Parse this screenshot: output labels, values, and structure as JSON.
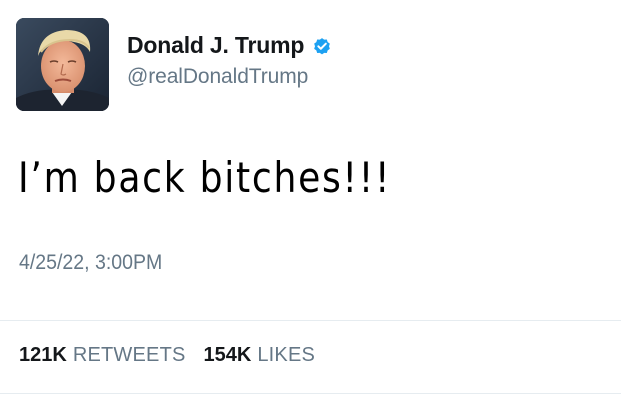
{
  "tweet": {
    "author": {
      "display_name": "Donald J. Trump",
      "handle": "@realDonaldTrump",
      "verified": true,
      "avatar": "profile-photo"
    },
    "text": "I’m back bitches!!!",
    "timestamp": "4/25/22, 3:00PM",
    "stats": {
      "retweets": {
        "count": "121K",
        "label": "RETWEETS"
      },
      "likes": {
        "count": "154K",
        "label": "LIKES"
      }
    }
  },
  "colors": {
    "verified_blue": "#1da1f2",
    "text_primary": "#14171a",
    "text_secondary": "#657786",
    "divider": "#e6ecf0"
  },
  "icons": {
    "verified": "verified-badge-icon"
  }
}
